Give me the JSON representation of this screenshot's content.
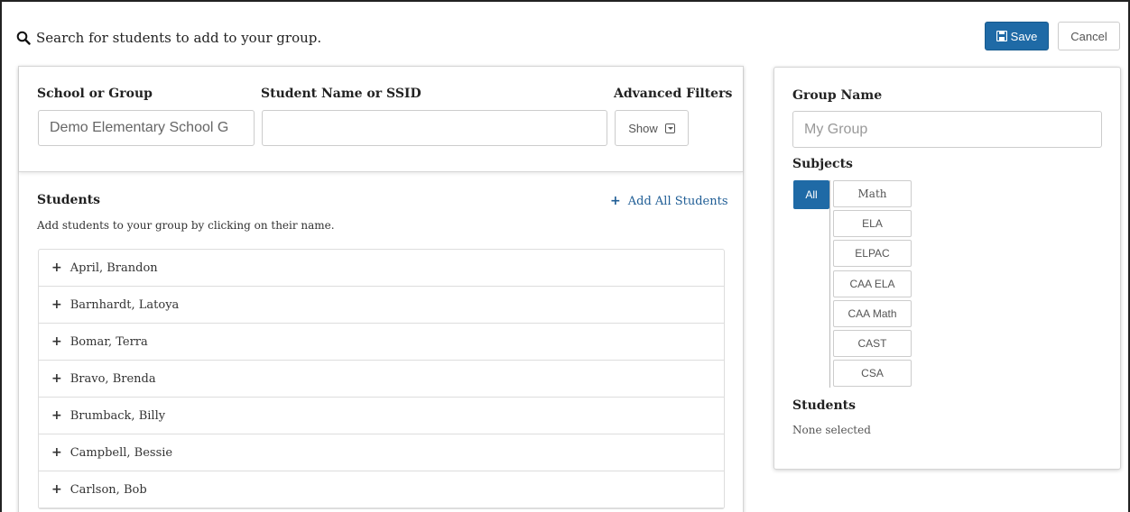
{
  "header": {
    "search_text": "Search for students to add to your group."
  },
  "toolbar": {
    "save_label": "Save",
    "cancel_label": "Cancel",
    "accent_color": "#1f6aa6"
  },
  "filters": {
    "school_label": "School or Group",
    "school_value": "Demo Elementary School G",
    "student_label": "Student Name or SSID",
    "student_value": "",
    "advanced_label": "Advanced Filters",
    "show_label": "Show"
  },
  "students": {
    "title": "Students",
    "help": "Add students to your group by clicking on their name.",
    "add_all_label": "Add All Students",
    "items": [
      "April, Brandon",
      "Barnhardt, Latoya",
      "Bomar, Terra",
      "Bravo, Brenda",
      "Brumback, Billy",
      "Campbell, Bessie",
      "Carlson, Bob"
    ]
  },
  "group": {
    "name_label": "Group Name",
    "name_placeholder": "My Group",
    "subjects_label": "Subjects",
    "all_label": "All",
    "subjects": [
      "Math",
      "ELA",
      "ELPAC",
      "CAA ELA",
      "CAA Math",
      "CAST",
      "CSA"
    ],
    "students_label": "Students",
    "none_selected": "None selected"
  }
}
